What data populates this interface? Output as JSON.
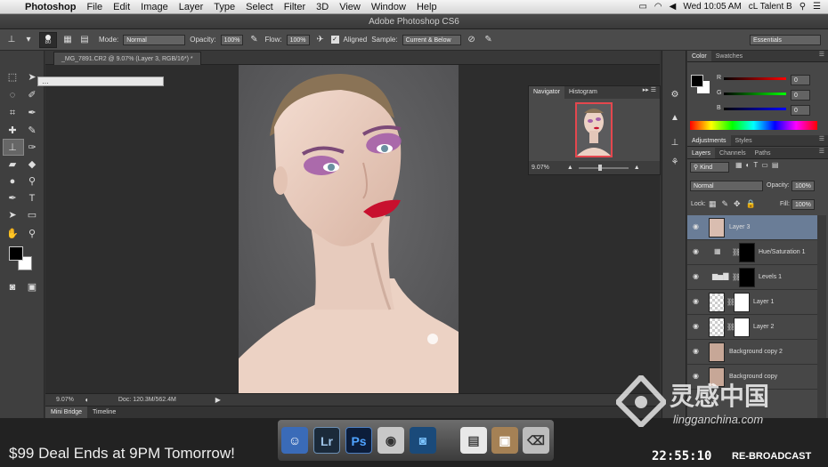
{
  "menubar": {
    "app": "Photoshop",
    "menus": [
      "File",
      "Edit",
      "Image",
      "Layer",
      "Type",
      "Select",
      "Filter",
      "3D",
      "View",
      "Window",
      "Help"
    ],
    "clock": "Wed 10:05 AM",
    "user": "cL Talent B"
  },
  "window": {
    "title": "Adobe Photoshop CS6"
  },
  "options": {
    "brush_size": "80",
    "mode_label": "Mode:",
    "mode_value": "Normal",
    "opacity_label": "Opacity:",
    "opacity_value": "100%",
    "flow_label": "Flow:",
    "flow_value": "100%",
    "aligned_label": "Aligned",
    "sample_label": "Sample:",
    "sample_value": "Current & Below",
    "workspace": "Essentials"
  },
  "document": {
    "tab_label": "_MG_7891.CR2 @ 9.07% (Layer 3, RGB/16*) *",
    "zoom": "9.07%",
    "doc_size": "Doc: 120.3M/562.4M"
  },
  "bottom_tabs": [
    "Mini Bridge",
    "Timeline"
  ],
  "navigator": {
    "tabs": [
      "Navigator",
      "Histogram"
    ],
    "zoom": "9.07%"
  },
  "color_panel": {
    "tabs": [
      "Color",
      "Swatches"
    ],
    "r_label": "R",
    "g_label": "G",
    "b_label": "B",
    "r": "0",
    "g": "0",
    "b": "0"
  },
  "adjustments": {
    "tabs": [
      "Adjustments",
      "Styles"
    ]
  },
  "layers_panel": {
    "tabs": [
      "Layers",
      "Channels",
      "Paths"
    ],
    "kind": "Kind",
    "blend_mode": "Normal",
    "opacity_label": "Opacity:",
    "opacity": "100%",
    "lock_label": "Lock:",
    "fill_label": "Fill:",
    "fill": "100%",
    "layers": [
      "Layer 3",
      "Hue/Saturation 1",
      "Levels 1",
      "Layer 1",
      "Layer 2",
      "Background copy 2",
      "Background copy"
    ]
  },
  "taskbar": {
    "promo": "$99 Deal Ends at 9PM Tomorrow!",
    "clock": "22:55:10",
    "broadcast": "RE-BROADCAST"
  },
  "dock": {
    "apps": [
      "Lr",
      "Ps"
    ]
  },
  "watermark": {
    "title": "灵感中国",
    "url": "lingganchina.com"
  },
  "colors": {
    "selected_layer": "#6a7d97",
    "lip_red": "#c8102e"
  }
}
